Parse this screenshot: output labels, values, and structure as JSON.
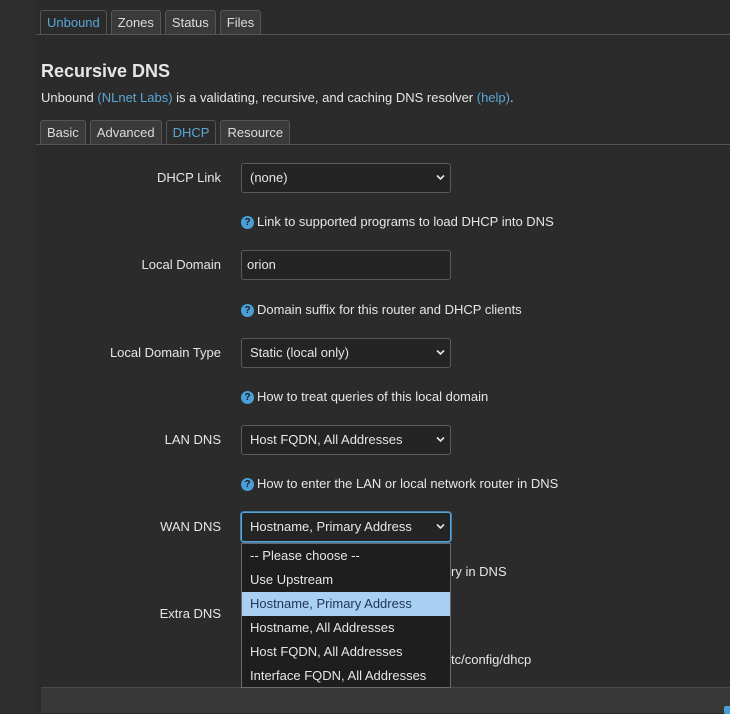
{
  "top_tabs": [
    "Unbound",
    "Zones",
    "Status",
    "Files"
  ],
  "title": "Recursive DNS",
  "desc": {
    "prefix": "Unbound ",
    "link1": "(NLnet Labs)",
    "middle": " is a validating, recursive, and caching DNS resolver ",
    "link2": "(help)",
    "suffix": "."
  },
  "sub_tabs": [
    "Basic",
    "Advanced",
    "DHCP",
    "Resource"
  ],
  "fields": {
    "dhcp_link": {
      "label": "DHCP Link",
      "value": "(none)",
      "help": "Link to supported programs to load DHCP into DNS"
    },
    "local_domain": {
      "label": "Local Domain",
      "value": "orion",
      "help": "Domain suffix for this router and DHCP clients"
    },
    "local_domain_type": {
      "label": "Local Domain Type",
      "value": "Static (local only)",
      "help": "How to treat queries of this local domain"
    },
    "lan_dns": {
      "label": "LAN DNS",
      "value": "Host FQDN, All Addresses",
      "help": "How to enter the LAN or local network router in DNS"
    },
    "wan_dns": {
      "label": "WAN DNS",
      "value": "Hostname, Primary Address",
      "help_visible_tail": "ry in DNS"
    },
    "extra_dns": {
      "label": "Extra DNS",
      "help_visible_tail": "tc/config/dhcp"
    }
  },
  "wan_dns_options": [
    "-- Please choose --",
    "Use Upstream",
    "Hostname, Primary Address",
    "Hostname, All Addresses",
    "Host FQDN, All Addresses",
    "Interface FQDN, All Addresses"
  ],
  "wan_dns_selected_index": 2,
  "colors": {
    "accent": "#5aa6d6",
    "help_icon": "#4a9fd8",
    "selected_option": "#a9cff2"
  },
  "icons": {
    "help": "question-circle-icon",
    "select": "chevron-down-icon"
  }
}
